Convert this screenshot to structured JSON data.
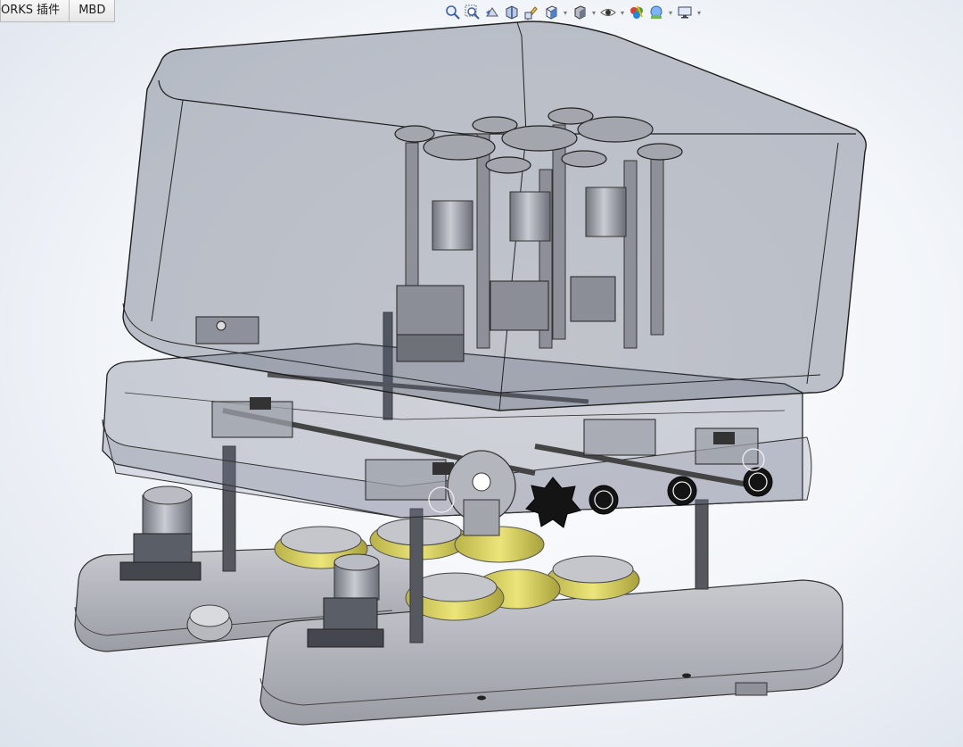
{
  "tabs": [
    {
      "label": "ORKS 插件"
    },
    {
      "label": "MBD"
    }
  ],
  "hud": {
    "icons": [
      "zoom-to-fit-icon",
      "zoom-to-area-icon",
      "previous-view-icon",
      "section-view-icon",
      "dynamic-annotation-icon",
      "view-orientation-icon",
      "display-style-icon",
      "hide-show-items-icon",
      "edit-appearance-icon",
      "apply-scene-icon",
      "view-settings-icon"
    ]
  },
  "colors": {
    "enclosure": "#5a6278",
    "steel": "#8f939b",
    "brass": "#d6cf6a",
    "knob": "#141414"
  }
}
